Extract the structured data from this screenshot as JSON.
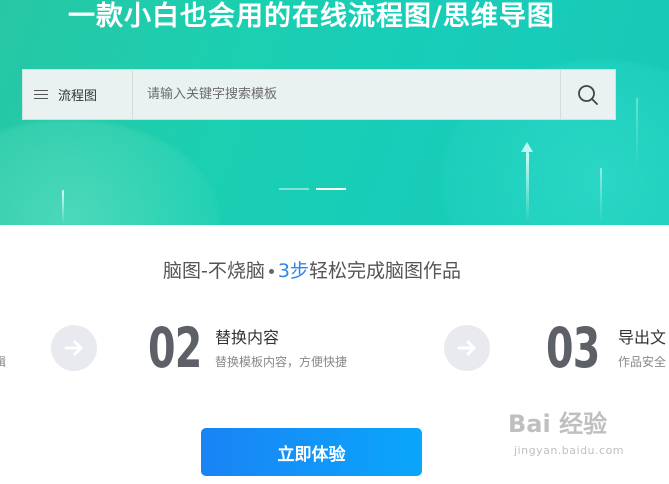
{
  "hero": {
    "title": "一款小白也会用的在线流程图/思维导图",
    "search": {
      "category_label": "流程图",
      "placeholder": "请输入关键字搜索模板"
    },
    "carousel": {
      "slides": 2,
      "active": 2
    }
  },
  "steps": {
    "heading_prefix": "脑图-不烧脑",
    "heading_number": "3步",
    "heading_suffix": "轻松完成脑图作品",
    "left_partial": "辑",
    "items": [
      {
        "number": "02",
        "title": "替换内容",
        "desc": "替换模板内容，方便快捷"
      },
      {
        "number": "03",
        "title": "导出文",
        "desc": "作品安全"
      }
    ]
  },
  "cta": {
    "label": "立即体验"
  },
  "watermark": {
    "brand": "Bai  经验",
    "url": "jingyan.baidu.com"
  },
  "colors": {
    "hero": "#1bcfb1",
    "accent": "#2f86e8",
    "cta": "#1a83f5"
  }
}
